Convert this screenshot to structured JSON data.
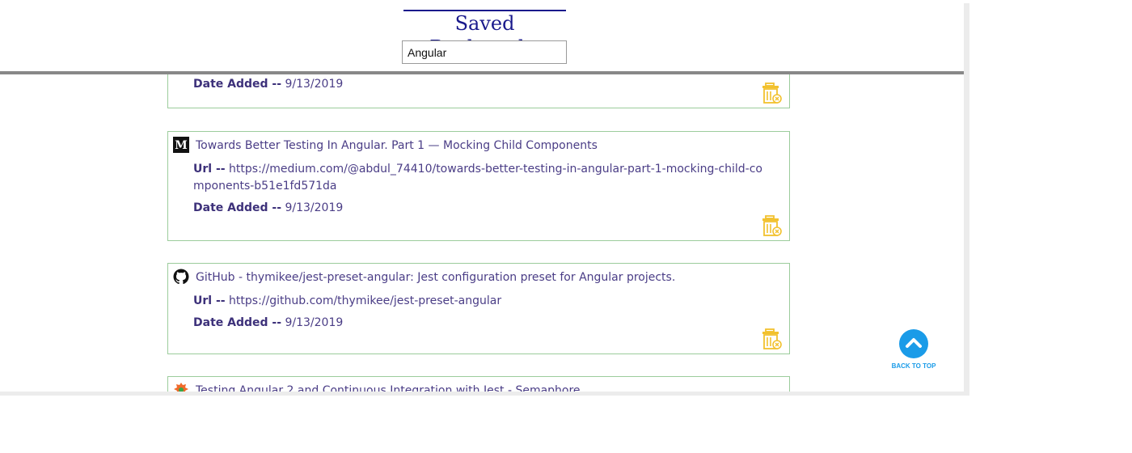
{
  "header": {
    "title": "Saved Bookmarks",
    "search_value": "Angular"
  },
  "labels": {
    "url": "Url --",
    "date_added": "Date Added --"
  },
  "bookmarks": [
    {
      "title": "",
      "favicon": "none",
      "url": "",
      "date": "9/13/2019"
    },
    {
      "title": "Towards Better Testing In Angular. Part 1 — Mocking Child Components",
      "favicon": "medium-icon",
      "url": "https://medium.com/@abdul_74410/towards-better-testing-in-angular-part-1-mocking-child-components-b51e1fd571da",
      "date": "9/13/2019"
    },
    {
      "title": "GitHub - thymikee/jest-preset-angular: Jest configuration preset for Angular projects.",
      "favicon": "github-icon",
      "url": "https://github.com/thymikee/jest-preset-angular",
      "date": "9/13/2019"
    },
    {
      "title": "Testing Angular 2 and Continuous Integration with Jest - Semaphore",
      "favicon": "semaphore-icon",
      "url": "",
      "date": ""
    }
  ],
  "back_to_top": {
    "label": "BACK TO TOP",
    "icon": "chevron-up-icon"
  },
  "colors": {
    "title": "#1a1a8c",
    "text": "#4a3d86",
    "card_border": "#9ccc9c",
    "trash": "#f2c12e",
    "accent": "#1a9be8"
  }
}
